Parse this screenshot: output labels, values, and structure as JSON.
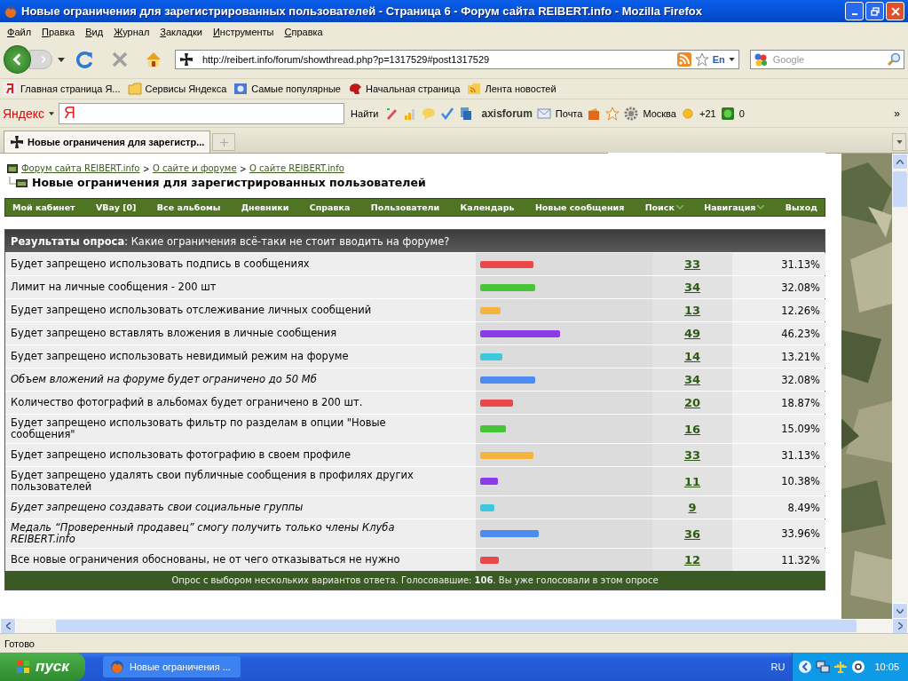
{
  "window": {
    "title": "Новые ограничения для зарегистрированных пользователей - Страница 6 - Форум сайта REIBERT.info - Mozilla Firefox"
  },
  "menu": [
    "Файл",
    "Правка",
    "Вид",
    "Журнал",
    "Закладки",
    "Инструменты",
    "Справка"
  ],
  "address": {
    "value": "http://reibert.info/forum/showthread.php?p=1317529#post1317529",
    "language": "En"
  },
  "search": {
    "placeholder": "Google"
  },
  "bookmarks": [
    {
      "kind": "yandex",
      "label": "Главная страница Я..."
    },
    {
      "kind": "folder",
      "label": "Сервисы Яндекса"
    },
    {
      "kind": "page",
      "label": "Самые популярные"
    },
    {
      "kind": "logo",
      "label": "Начальная страница"
    },
    {
      "kind": "feed",
      "label": "Лента новостей"
    }
  ],
  "yandex_bar": {
    "brand": "Яндекс",
    "field_logo": "Я",
    "find": "Найти",
    "site": "axisforum",
    "mail": "Почта",
    "city": "Москва",
    "temperature": "+21",
    "counter": "0",
    "more": "»"
  },
  "tabs": [
    {
      "label": "Новые ограничения для зарегистр...",
      "selected": true
    }
  ],
  "breadcrumb": {
    "links": [
      "Форум сайта REIBERT.info",
      "О сайте и форуме",
      "О сайте REIBERT.info"
    ],
    "separator": ">"
  },
  "thread_title": "Новые ограничения для зарегистрированных пользователей",
  "nav": [
    {
      "label": "Мой кабинет",
      "dropdown": false
    },
    {
      "label": "VBay [0]",
      "dropdown": false
    },
    {
      "label": "Все альбомы",
      "dropdown": false
    },
    {
      "label": "Дневники",
      "dropdown": false
    },
    {
      "label": "Справка",
      "dropdown": false
    },
    {
      "label": "Пользователи",
      "dropdown": false
    },
    {
      "label": "Календарь",
      "dropdown": false
    },
    {
      "label": "Новые сообщения",
      "dropdown": false
    },
    {
      "label": "Поиск",
      "dropdown": true
    },
    {
      "label": "Навигация",
      "dropdown": true
    },
    {
      "label": "Выход",
      "dropdown": false
    }
  ],
  "poll": {
    "header": "**Результаты опроса**: Какие ограничения всё-таки не стоит вводить на форуме?",
    "options": [
      {
        "text": "Будет запрещено использовать подпись в сообщениях",
        "italic": false,
        "color": "#e84848",
        "level": 0.31,
        "votes": "33",
        "percent": "31.13%"
      },
      {
        "text": "Лимит на личные сообщения - 200 шт",
        "italic": false,
        "color": "#48c438",
        "level": 0.32,
        "votes": "34",
        "percent": "32.08%"
      },
      {
        "text": "Будет запрещено использовать отслеживание личных сообщений",
        "italic": false,
        "color": "#f5b43c",
        "level": 0.12,
        "votes": "13",
        "percent": "12.26%"
      },
      {
        "text": "Будет запрещено вставлять вложения в личные сообщения",
        "italic": false,
        "color": "#8c3ce6",
        "level": 0.46,
        "votes": "49",
        "percent": "46.23%"
      },
      {
        "text": "Будет запрещено использовать невидимый режим на форуме",
        "italic": false,
        "color": "#3cc8e0",
        "level": 0.13,
        "votes": "14",
        "percent": "13.21%"
      },
      {
        "text": "Объем вложений на форуме будет ограничено до 50 Мб",
        "italic": true,
        "color": "#4c8cf0",
        "level": 0.32,
        "votes": "34",
        "percent": "32.08%"
      },
      {
        "text": "Количество фотографий в альбомах будет ограничено в 200 шт.",
        "italic": false,
        "color": "#e84848",
        "level": 0.19,
        "votes": "20",
        "percent": "18.87%"
      },
      {
        "text": "Будет запрещено использовать фильтр по разделам в опции \"Новые сообщения\"",
        "italic": false,
        "color": "#48c438",
        "level": 0.15,
        "votes": "16",
        "percent": "15.09%"
      },
      {
        "text": "Будет запрещено использовать фотографию в своем профиле",
        "italic": false,
        "color": "#f5b43c",
        "level": 0.31,
        "votes": "33",
        "percent": "31.13%"
      },
      {
        "text": "Будет запрещено удалять свои публичные сообщения в профилях других пользователей",
        "italic": false,
        "color": "#8c3ce6",
        "level": 0.1,
        "votes": "11",
        "percent": "10.38%"
      },
      {
        "text": "Будет запрещено создавать свои социальные группы",
        "italic": true,
        "color": "#3cc8e0",
        "level": 0.08,
        "votes": "9",
        "percent": "8.49%"
      },
      {
        "text": "Медаль “Проверенный продавец” смогу получить только члены Клуба REIBERT.info",
        "italic": true,
        "color": "#4c8cf0",
        "level": 0.34,
        "votes": "36",
        "percent": "33.96%"
      },
      {
        "text": "Все новые ограничения обоснованы, не от чего отказываться не нужно",
        "italic": false,
        "color": "#e84848",
        "level": 0.11,
        "votes": "12",
        "percent": "11.32%"
      }
    ],
    "footer": "Опрос с выбором нескольких вариантов ответа. Голосовавшие: **106**. Вы уже голосовали в этом опросе"
  },
  "status": "Готово",
  "taskbar": {
    "start": "пуск",
    "windows": [
      {
        "label": "Новые ограничения ...",
        "selected": false
      }
    ],
    "language": "RU",
    "clock": "10:05"
  }
}
